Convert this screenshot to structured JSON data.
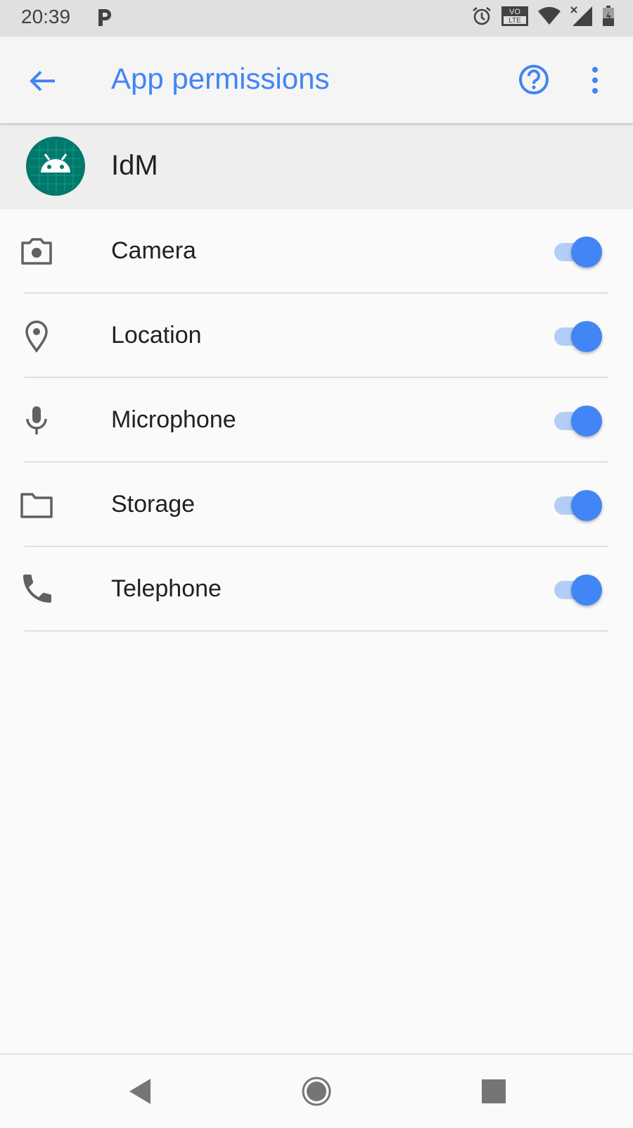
{
  "status_bar": {
    "time": "20:39",
    "icons": [
      "parking-icon",
      "alarm-icon",
      "volte-icon",
      "wifi-icon",
      "signal-icon",
      "battery-icon"
    ],
    "volte_top": "VO",
    "volte_bottom": "LTE"
  },
  "app_bar": {
    "title": "App permissions",
    "icons": [
      "back-arrow-icon",
      "help-icon",
      "more-vert-icon"
    ]
  },
  "app_header": {
    "name": "IdM",
    "logo_icon": "android-icon"
  },
  "permissions": [
    {
      "label": "Camera",
      "icon": "camera-icon",
      "enabled": true
    },
    {
      "label": "Location",
      "icon": "location-icon",
      "enabled": true
    },
    {
      "label": "Microphone",
      "icon": "microphone-icon",
      "enabled": true
    },
    {
      "label": "Storage",
      "icon": "folder-icon",
      "enabled": true
    },
    {
      "label": "Telephone",
      "icon": "phone-icon",
      "enabled": true
    }
  ],
  "nav_bar": {
    "icons": [
      "back-triangle-icon",
      "home-circle-icon",
      "recents-square-icon"
    ]
  },
  "colors": {
    "accent": "#4285f4",
    "track_on": "#b3cdf7",
    "logo_bg": "#00796b",
    "text_primary": "#212121",
    "icon_grey": "#616161"
  }
}
